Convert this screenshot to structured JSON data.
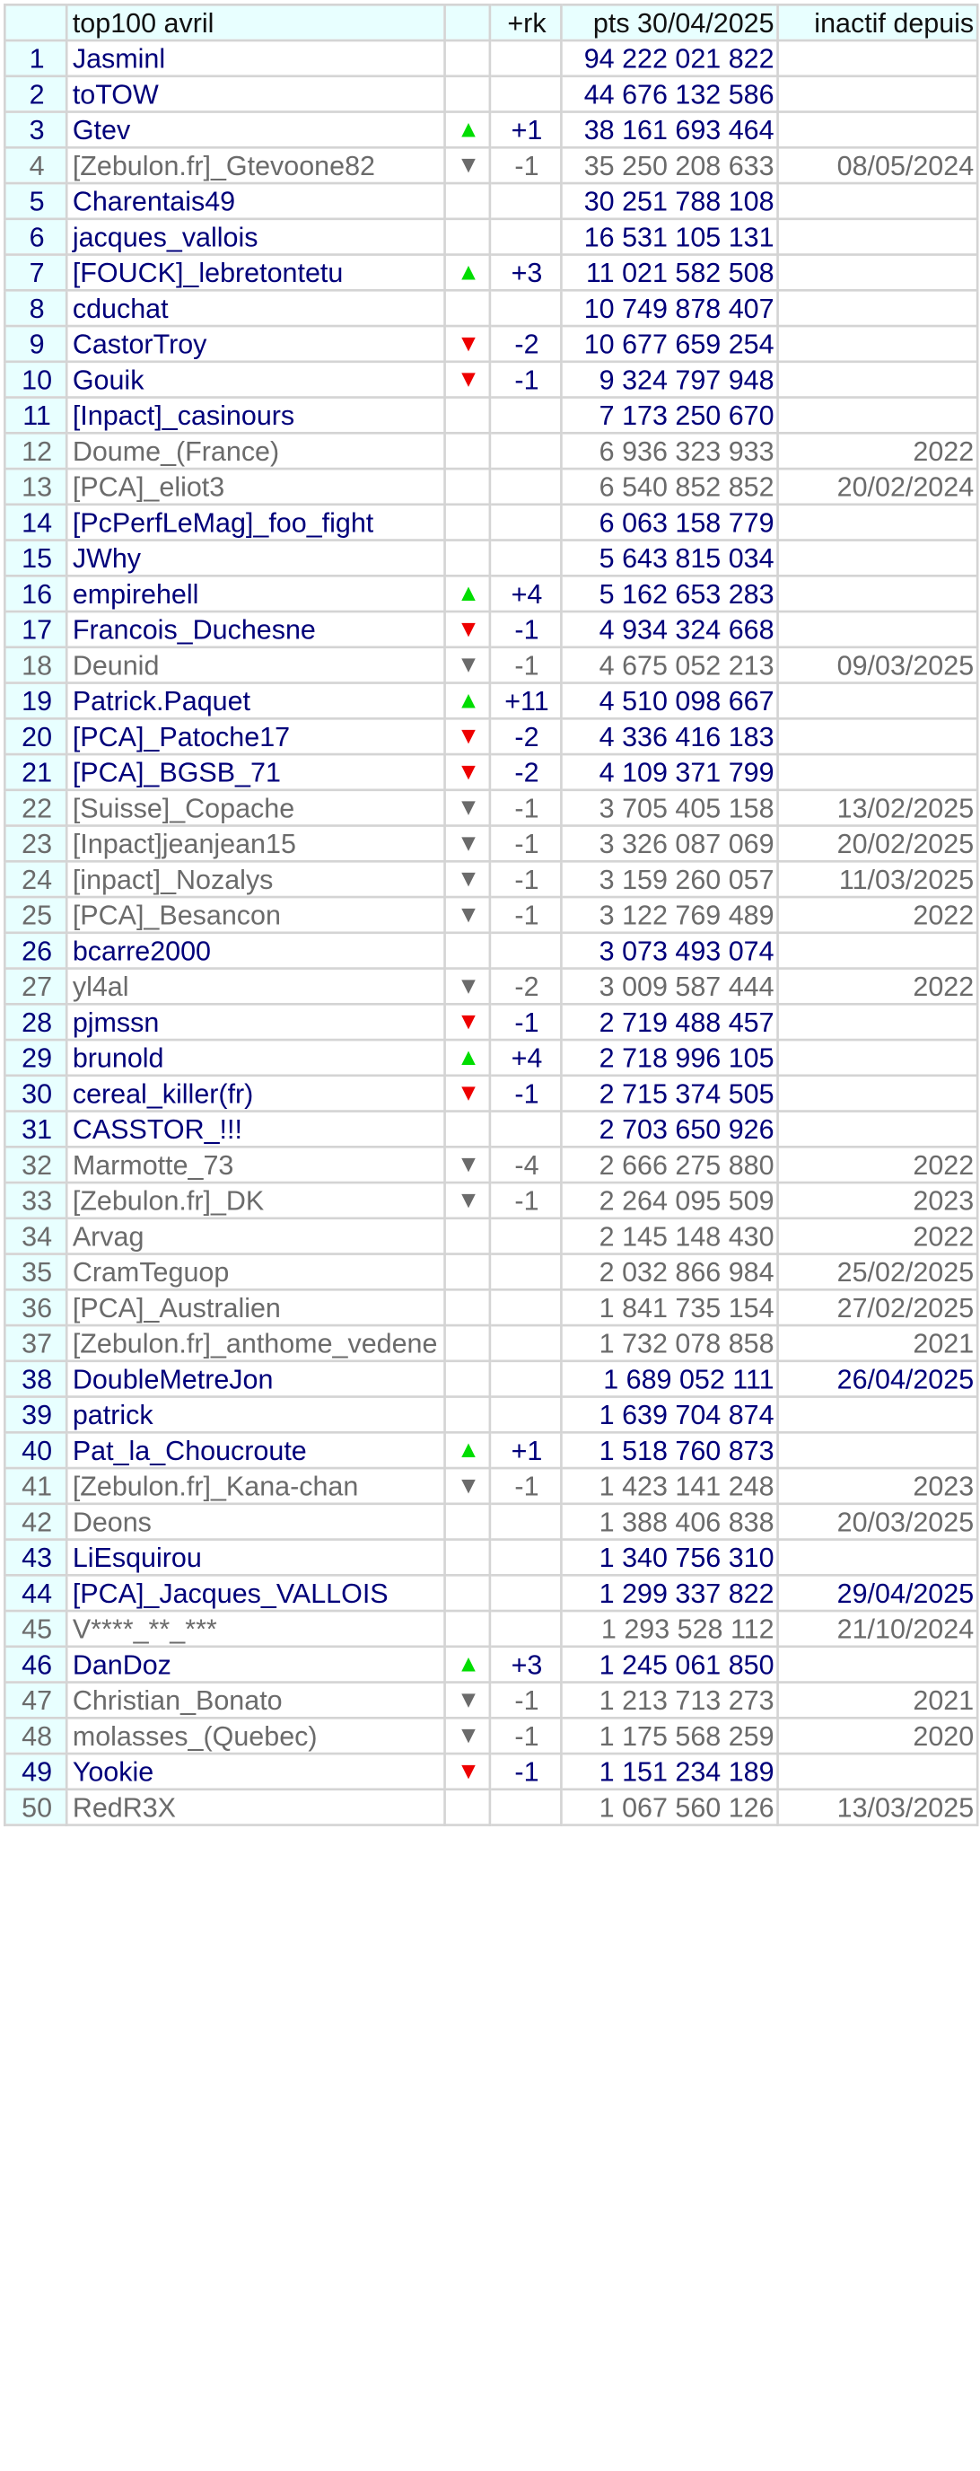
{
  "header": {
    "name": "top100 avril",
    "delta": "+rk",
    "points": "pts 30/04/2025",
    "inactive": "inactif depuis"
  },
  "colors": {
    "active_text": "#00007a",
    "inactive_text": "#6b6b6b",
    "up_arrow": "#00dd00",
    "down_arrow_active": "#ee0000",
    "down_arrow_inactive": "#6b6b6b",
    "header_bg": "#e8ffff",
    "grid": "#d4d4d4"
  },
  "rows": [
    {
      "rank": "1",
      "name": "Jasminl",
      "arrow": "",
      "delta": "",
      "points": "94 222 021 822",
      "inactive": "",
      "state": "active"
    },
    {
      "rank": "2",
      "name": "toTOW",
      "arrow": "",
      "delta": "",
      "points": "44 676 132 586",
      "inactive": "",
      "state": "active"
    },
    {
      "rank": "3",
      "name": "Gtev",
      "arrow": "up",
      "delta": "+1",
      "points": "38 161 693 464",
      "inactive": "",
      "state": "active"
    },
    {
      "rank": "4",
      "name": "[Zebulon.fr]_Gtevoone82",
      "arrow": "down",
      "delta": "-1",
      "points": "35 250 208 633",
      "inactive": "08/05/2024",
      "state": "inactive"
    },
    {
      "rank": "5",
      "name": "Charentais49",
      "arrow": "",
      "delta": "",
      "points": "30 251 788 108",
      "inactive": "",
      "state": "active"
    },
    {
      "rank": "6",
      "name": "jacques_vallois",
      "arrow": "",
      "delta": "",
      "points": "16 531 105 131",
      "inactive": "",
      "state": "active"
    },
    {
      "rank": "7",
      "name": "[FOUCK]_lebretontetu",
      "arrow": "up",
      "delta": "+3",
      "points": "11 021 582 508",
      "inactive": "",
      "state": "active"
    },
    {
      "rank": "8",
      "name": "cduchat",
      "arrow": "",
      "delta": "",
      "points": "10 749 878 407",
      "inactive": "",
      "state": "active"
    },
    {
      "rank": "9",
      "name": "CastorTroy",
      "arrow": "down",
      "delta": "-2",
      "points": "10 677 659 254",
      "inactive": "",
      "state": "active"
    },
    {
      "rank": "10",
      "name": "Gouik",
      "arrow": "down",
      "delta": "-1",
      "points": "9 324 797 948",
      "inactive": "",
      "state": "active"
    },
    {
      "rank": "11",
      "name": "[Inpact]_casinours",
      "arrow": "",
      "delta": "",
      "points": "7 173 250 670",
      "inactive": "",
      "state": "active"
    },
    {
      "rank": "12",
      "name": "Doume_(France)",
      "arrow": "",
      "delta": "",
      "points": "6 936 323 933",
      "inactive": "2022",
      "state": "inactive"
    },
    {
      "rank": "13",
      "name": "[PCA]_eliot3",
      "arrow": "",
      "delta": "",
      "points": "6 540 852 852",
      "inactive": "20/02/2024",
      "state": "inactive"
    },
    {
      "rank": "14",
      "name": "[PcPerfLeMag]_foo_fight",
      "arrow": "",
      "delta": "",
      "points": "6 063 158 779",
      "inactive": "",
      "state": "active"
    },
    {
      "rank": "15",
      "name": "JWhy",
      "arrow": "",
      "delta": "",
      "points": "5 643 815 034",
      "inactive": "",
      "state": "active"
    },
    {
      "rank": "16",
      "name": "empirehell",
      "arrow": "up",
      "delta": "+4",
      "points": "5 162 653 283",
      "inactive": "",
      "state": "active"
    },
    {
      "rank": "17",
      "name": "Francois_Duchesne",
      "arrow": "down",
      "delta": "-1",
      "points": "4 934 324 668",
      "inactive": "",
      "state": "active"
    },
    {
      "rank": "18",
      "name": "Deunid",
      "arrow": "down",
      "delta": "-1",
      "points": "4 675 052 213",
      "inactive": "09/03/2025",
      "state": "inactive"
    },
    {
      "rank": "19",
      "name": "Patrick.Paquet",
      "arrow": "up",
      "delta": "+11",
      "points": "4 510 098 667",
      "inactive": "",
      "state": "active"
    },
    {
      "rank": "20",
      "name": "[PCA]_Patoche17",
      "arrow": "down",
      "delta": "-2",
      "points": "4 336 416 183",
      "inactive": "",
      "state": "active"
    },
    {
      "rank": "21",
      "name": "[PCA]_BGSB_71",
      "arrow": "down",
      "delta": "-2",
      "points": "4 109 371 799",
      "inactive": "",
      "state": "active"
    },
    {
      "rank": "22",
      "name": "[Suisse]_Copache",
      "arrow": "down",
      "delta": "-1",
      "points": "3 705 405 158",
      "inactive": "13/02/2025",
      "state": "inactive"
    },
    {
      "rank": "23",
      "name": "[Inpact]jeanjean15",
      "arrow": "down",
      "delta": "-1",
      "points": "3 326 087 069",
      "inactive": "20/02/2025",
      "state": "inactive"
    },
    {
      "rank": "24",
      "name": "[inpact]_Nozalys",
      "arrow": "down",
      "delta": "-1",
      "points": "3 159 260 057",
      "inactive": "11/03/2025",
      "state": "inactive"
    },
    {
      "rank": "25",
      "name": "[PCA]_Besancon",
      "arrow": "down",
      "delta": "-1",
      "points": "3 122 769 489",
      "inactive": "2022",
      "state": "inactive"
    },
    {
      "rank": "26",
      "name": "bcarre2000",
      "arrow": "",
      "delta": "",
      "points": "3 073 493 074",
      "inactive": "",
      "state": "active"
    },
    {
      "rank": "27",
      "name": "yl4al",
      "arrow": "down",
      "delta": "-2",
      "points": "3 009 587 444",
      "inactive": "2022",
      "state": "inactive"
    },
    {
      "rank": "28",
      "name": "pjmssn",
      "arrow": "down",
      "delta": "-1",
      "points": "2 719 488 457",
      "inactive": "",
      "state": "active"
    },
    {
      "rank": "29",
      "name": "brunold",
      "arrow": "up",
      "delta": "+4",
      "points": "2 718 996 105",
      "inactive": "",
      "state": "active"
    },
    {
      "rank": "30",
      "name": "cereal_killer(fr)",
      "arrow": "down",
      "delta": "-1",
      "points": "2 715 374 505",
      "inactive": "",
      "state": "active"
    },
    {
      "rank": "31",
      "name": "CASSTOR_!!!",
      "arrow": "",
      "delta": "",
      "points": "2 703 650 926",
      "inactive": "",
      "state": "active"
    },
    {
      "rank": "32",
      "name": "Marmotte_73",
      "arrow": "down",
      "delta": "-4",
      "points": "2 666 275 880",
      "inactive": "2022",
      "state": "inactive"
    },
    {
      "rank": "33",
      "name": "[Zebulon.fr]_DK",
      "arrow": "down",
      "delta": "-1",
      "points": "2 264 095 509",
      "inactive": "2023",
      "state": "inactive"
    },
    {
      "rank": "34",
      "name": "Arvag",
      "arrow": "",
      "delta": "",
      "points": "2 145 148 430",
      "inactive": "2022",
      "state": "inactive"
    },
    {
      "rank": "35",
      "name": "CramTeguop",
      "arrow": "",
      "delta": "",
      "points": "2 032 866 984",
      "inactive": "25/02/2025",
      "state": "inactive"
    },
    {
      "rank": "36",
      "name": "[PCA]_Australien",
      "arrow": "",
      "delta": "",
      "points": "1 841 735 154",
      "inactive": "27/02/2025",
      "state": "inactive"
    },
    {
      "rank": "37",
      "name": "[Zebulon.fr]_anthome_vedene",
      "arrow": "",
      "delta": "",
      "points": "1 732 078 858",
      "inactive": "2021",
      "state": "inactive"
    },
    {
      "rank": "38",
      "name": "DoubleMetreJon",
      "arrow": "",
      "delta": "",
      "points": "1 689 052 111",
      "inactive": "26/04/2025",
      "state": "active"
    },
    {
      "rank": "39",
      "name": "patrick",
      "arrow": "",
      "delta": "",
      "points": "1 639 704 874",
      "inactive": "",
      "state": "active"
    },
    {
      "rank": "40",
      "name": "Pat_la_Choucroute",
      "arrow": "up",
      "delta": "+1",
      "points": "1 518 760 873",
      "inactive": "",
      "state": "active"
    },
    {
      "rank": "41",
      "name": "[Zebulon.fr]_Kana-chan",
      "arrow": "down",
      "delta": "-1",
      "points": "1 423 141 248",
      "inactive": "2023",
      "state": "inactive"
    },
    {
      "rank": "42",
      "name": "Deons",
      "arrow": "",
      "delta": "",
      "points": "1 388 406 838",
      "inactive": "20/03/2025",
      "state": "inactive"
    },
    {
      "rank": "43",
      "name": "LiEsquirou",
      "arrow": "",
      "delta": "",
      "points": "1 340 756 310",
      "inactive": "",
      "state": "active"
    },
    {
      "rank": "44",
      "name": "[PCA]_Jacques_VALLOIS",
      "arrow": "",
      "delta": "",
      "points": "1 299 337 822",
      "inactive": "29/04/2025",
      "state": "active"
    },
    {
      "rank": "45",
      "name": "V****_**_***",
      "arrow": "",
      "delta": "",
      "points": "1 293 528 112",
      "inactive": "21/10/2024",
      "state": "inactive"
    },
    {
      "rank": "46",
      "name": "DanDoz",
      "arrow": "up",
      "delta": "+3",
      "points": "1 245 061 850",
      "inactive": "",
      "state": "active"
    },
    {
      "rank": "47",
      "name": "Christian_Bonato",
      "arrow": "down",
      "delta": "-1",
      "points": "1 213 713 273",
      "inactive": "2021",
      "state": "inactive"
    },
    {
      "rank": "48",
      "name": "molasses_(Quebec)",
      "arrow": "down",
      "delta": "-1",
      "points": "1 175 568 259",
      "inactive": "2020",
      "state": "inactive"
    },
    {
      "rank": "49",
      "name": "Yookie",
      "arrow": "down",
      "delta": "-1",
      "points": "1 151 234 189",
      "inactive": "",
      "state": "active"
    },
    {
      "rank": "50",
      "name": "RedR3X",
      "arrow": "",
      "delta": "",
      "points": "1 067 560 126",
      "inactive": "13/03/2025",
      "state": "inactive"
    }
  ]
}
